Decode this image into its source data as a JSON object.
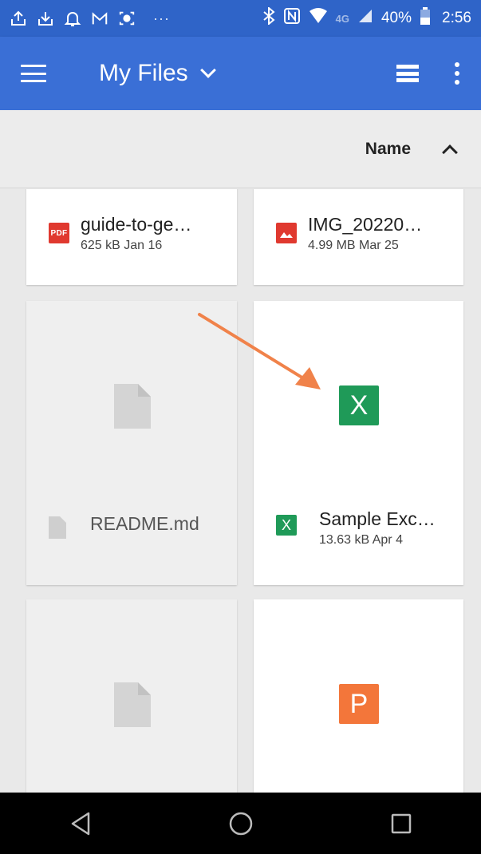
{
  "status_bar": {
    "network_label": "4G",
    "battery_percent": "40%",
    "time": "2:56",
    "icons": [
      "upload-icon",
      "download-icon",
      "bell-icon",
      "gmail-icon",
      "camera-icon",
      "more-notifications-icon",
      "bluetooth-icon",
      "nfc-icon",
      "wifi-icon",
      "signal-icon",
      "battery-icon"
    ]
  },
  "toolbar": {
    "title": "My Files",
    "icons": [
      "menu-icon",
      "chevron-down-icon",
      "list-view-icon",
      "more-vert-icon"
    ]
  },
  "sort": {
    "label": "Name",
    "direction": "ascending"
  },
  "files": [
    {
      "name": "guide-to-ge…",
      "meta": "625 kB Jan 16",
      "icon": "pdf-icon",
      "icon_text": "PDF"
    },
    {
      "name": "IMG_20220…",
      "meta": "4.99 MB Mar 25",
      "icon": "image-icon"
    },
    {
      "name": "README.md",
      "meta": "",
      "icon": "document-icon"
    },
    {
      "name": "Sample Exc…",
      "meta": "13.63 kB Apr 4",
      "icon": "excel-icon",
      "icon_text": "X"
    },
    {
      "name": "",
      "meta": "",
      "icon": "document-icon"
    },
    {
      "name": "",
      "meta": "",
      "icon": "powerpoint-icon",
      "icon_text": "P"
    }
  ],
  "colors": {
    "toolbar": "#3a6fd6",
    "status_bar": "#2f64c8",
    "excel": "#1f9a58",
    "pdf": "#e0392f",
    "powerpoint": "#f3763a",
    "annotation_arrow": "#f0824a"
  },
  "nav": {
    "icons": [
      "back-icon",
      "home-icon",
      "recents-icon"
    ]
  }
}
